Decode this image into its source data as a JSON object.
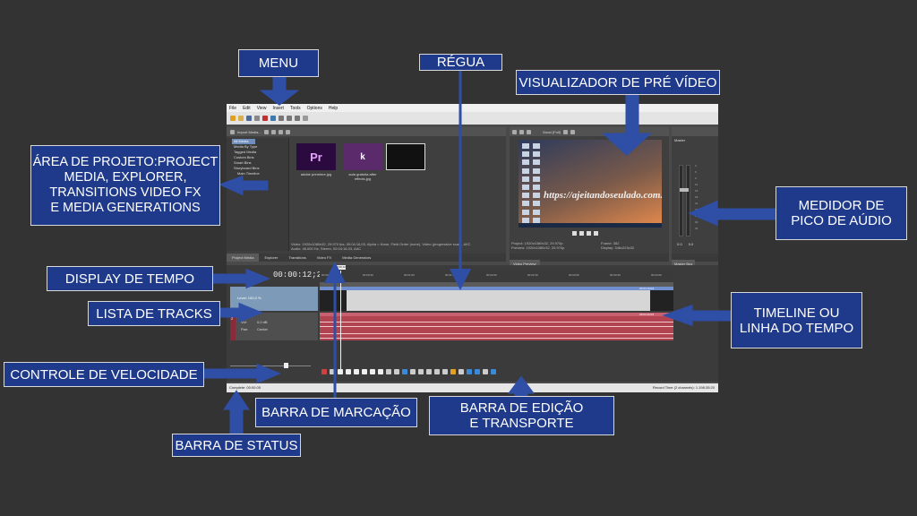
{
  "app": {
    "menu": [
      "File",
      "Edit",
      "View",
      "Insert",
      "Tools",
      "Options",
      "Help"
    ],
    "explorer": {
      "dropdown": "Import Media...",
      "tree": [
        "All Media",
        "Media By Type",
        "Tagged Media",
        "Custom Bins",
        "Smart Bins",
        "Storyboard Bins",
        "Main Timeline"
      ],
      "thumbs": [
        {
          "caption": "adobe premiere.jpg",
          "label": "Pr",
          "color": "#2a0a3f"
        },
        {
          "caption": "aula gratuita after effects.jpg",
          "label": "k",
          "color": "#5a2a6a"
        },
        {
          "caption": "",
          "label": "",
          "color": "#111111"
        }
      ],
      "info_line1": "Video: 1920x1080x32, 29.970 fps, 00:04:16,03, Alpha = None, Field Order (none), Video (progressive scan), AVC",
      "info_line2": "Audio: 48.000 Hz, Stereo, 00:04:16,03, AAC",
      "tabs": [
        "Project Media",
        "Explorer",
        "Transitions",
        "Video FX",
        "Media Generators"
      ]
    },
    "preview": {
      "mode": "Good (Full)",
      "banner": "https://ajeitandoseulado.com.br",
      "info_project": "Project: 1920x1080x32, 29.970p",
      "info_preview": "Preview: 1920x1080x32, 29.970p",
      "info_frame": "Frame: 382",
      "info_display": "Display: 346x223x32",
      "tab": "Video Preview"
    },
    "master": {
      "title": "Master",
      "val_left": "0.0",
      "val_right": "0.0",
      "scale": [
        "3",
        "6",
        "9",
        "12",
        "15",
        "18",
        "21",
        "24",
        "27",
        "30",
        "33",
        "36",
        "39",
        "42",
        "45",
        "48",
        "51",
        "54",
        "57"
      ],
      "tab": "Master Bus"
    },
    "timeline": {
      "time": "00:00:12;22",
      "video_level": "Level: 100,0 %",
      "audio_vol": "Vol:",
      "audio_vol_val": "0,0 dB",
      "audio_pan": "Pan:",
      "audio_pan_val": "Center",
      "track_num": "2",
      "cursor_tag": "00:00:12",
      "ruler_ticks": [
        "00:00:00",
        "00:00:30",
        "00:01:00",
        "00:01:30",
        "00:02:00",
        "00:02:30",
        "00:03:00",
        "00:03:30",
        "00:04:00"
      ],
      "video_len": "00:04:16;03",
      "audio_len": "00:04:16;03"
    },
    "status": {
      "left": "Complete: 00:00:05",
      "right": "Record Time (2 channels): 1.198:35:20"
    }
  },
  "callouts": {
    "menu": "MENU",
    "regua": "RÉGUA",
    "visualizador": "VISUALIZADOR DE PRÉ VÍDEO",
    "area_projeto": "ÁREA DE PROJETO:PROJECT\nMEDIA, EXPLORER,\nTRANSITIONS VIDEO FX\nE MEDIA GENERATIONS",
    "medidor": "MEDIDOR DE\nPICO DE AÚDIO",
    "display_tempo": "DISPLAY DE TEMPO",
    "lista_tracks": "LISTA DE TRACKS",
    "timeline": "TIMELINE OU\nLINHA DO TEMPO",
    "controle_velocidade": "CONTROLE DE VELOCIDADE",
    "barra_marcacao": "BARRA DE MARCAÇÃO",
    "barra_edicao": "BARRA DE EDIÇÃO\nE TRANSPORTE",
    "barra_status": "BARRA DE STATUS"
  },
  "colors": {
    "callout_bg": "#1f3a8a",
    "arrow": "#2f4fa6",
    "audio_clip": "#b24452",
    "video_track": "#7d9bb8"
  }
}
